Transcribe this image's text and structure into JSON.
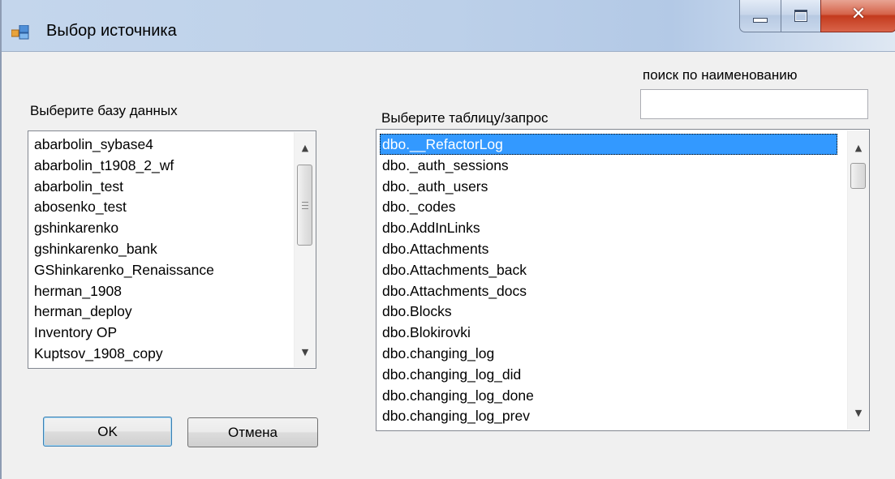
{
  "window": {
    "title": "Выбор источника",
    "controls": {
      "minimize": "minimize",
      "maximize": "maximize",
      "close": "close"
    }
  },
  "database": {
    "label": "Выберите базу данных",
    "items": [
      "abarbolin_sybase4",
      "abarbolin_t1908_2_wf",
      "abarbolin_test",
      "abosenko_test",
      "gshinkarenko",
      "gshinkarenko_bank",
      "GShinkarenko_Renaissance",
      "herman_1908",
      "herman_deploy",
      "Inventory OP",
      "Kuptsov_1908_copy"
    ]
  },
  "search": {
    "label": "поиск по наименованию",
    "value": ""
  },
  "table": {
    "label": "Выберите таблицу/запрос",
    "selected_index": 0,
    "items": [
      "dbo.__RefactorLog",
      "dbo._auth_sessions",
      "dbo._auth_users",
      "dbo._codes",
      "dbo.AddInLinks",
      "dbo.Attachments",
      "dbo.Attachments_back",
      "dbo.Attachments_docs",
      "dbo.Blocks",
      "dbo.Blokirovki",
      "dbo.changing_log",
      "dbo.changing_log_did",
      "dbo.changing_log_done",
      "dbo.changing_log_prev"
    ]
  },
  "buttons": {
    "ok": "OK",
    "cancel": "Отмена"
  },
  "colors": {
    "selection": "#3399ff",
    "titlebar": "#bcd0e9",
    "close_button": "#c33a1d"
  }
}
